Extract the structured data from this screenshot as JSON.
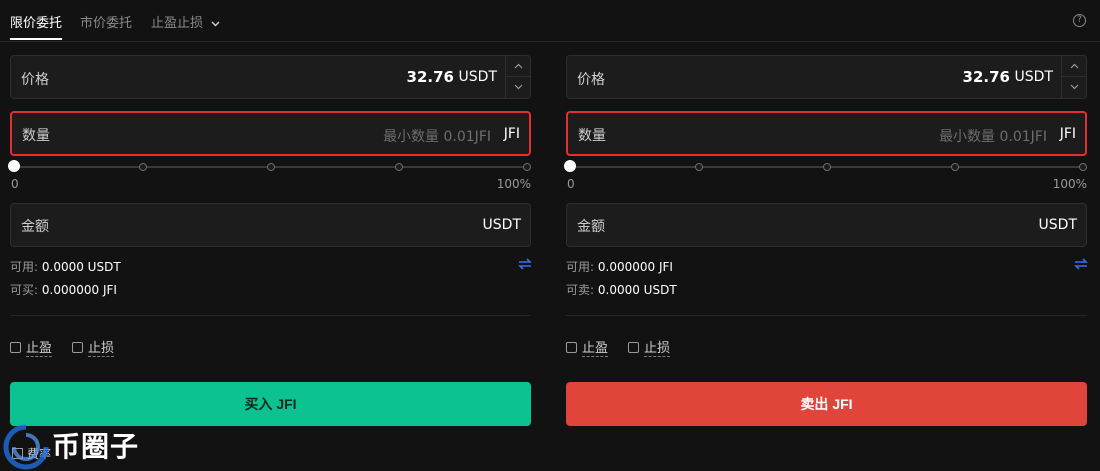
{
  "tabs": {
    "limit": "限价委托",
    "market": "市价委托",
    "tpsl": "止盈止损"
  },
  "buy": {
    "price_label": "价格",
    "price_value": "32.76",
    "price_unit": "USDT",
    "qty_label": "数量",
    "qty_placeholder": "最小数量 0.01JFI",
    "qty_unit": "JFI",
    "slider_min": "0",
    "slider_max": "100%",
    "slider_value_percent": 0,
    "amount_label": "金额",
    "amount_unit": "USDT",
    "avail_label": "可用:",
    "avail_value": "0.0000 USDT",
    "can_label": "可买:",
    "can_value": "0.000000 JFI",
    "tp_label": "止盈",
    "sl_label": "止损",
    "button": "买入 JFI"
  },
  "sell": {
    "price_label": "价格",
    "price_value": "32.76",
    "price_unit": "USDT",
    "qty_label": "数量",
    "qty_placeholder": "最小数量 0.01JFI",
    "qty_unit": "JFI",
    "slider_min": "0",
    "slider_max": "100%",
    "slider_value_percent": 0,
    "amount_label": "金额",
    "amount_unit": "USDT",
    "avail_label": "可用:",
    "avail_value": "0.000000 JFI",
    "can_label": "可卖:",
    "can_value": "0.0000 USDT",
    "tp_label": "止盈",
    "sl_label": "止损",
    "button": "卖出 JFI"
  },
  "fee_label": "费率",
  "watermark": "币圈子",
  "colors": {
    "buy": "#0cc290",
    "sell": "#e0443b",
    "highlight": "#e03030",
    "swap": "#3b6cf0"
  }
}
